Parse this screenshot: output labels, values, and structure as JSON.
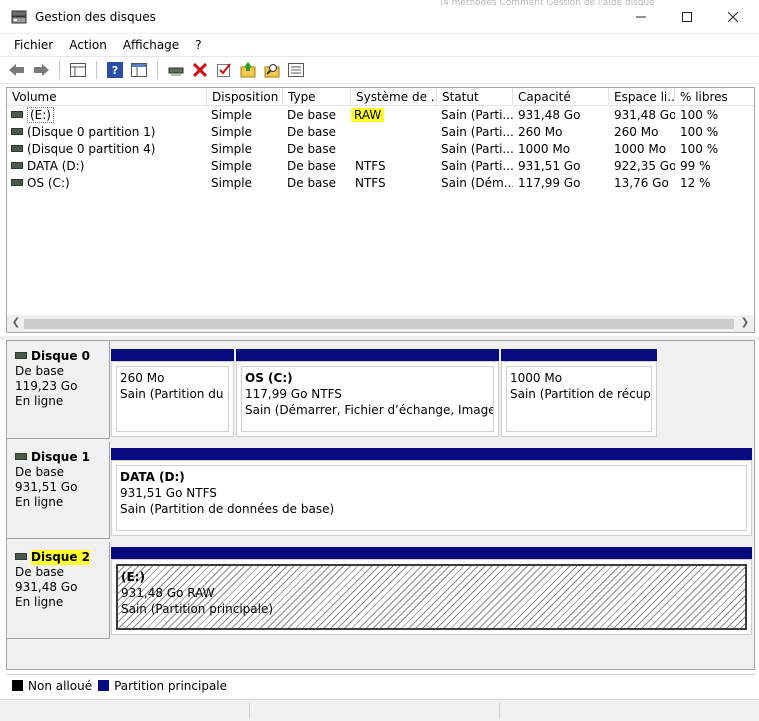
{
  "window": {
    "title": "Gestion des disques",
    "background_title_fragment": "|4 méthodes Comment Gestion de l'aide disque",
    "min_icon": "minimize-icon",
    "max_icon": "maximize-icon",
    "close_icon": "close-icon"
  },
  "menu": [
    "Fichier",
    "Action",
    "Affichage",
    "?"
  ],
  "toolbar": {
    "buttons": [
      "back-arrow-icon",
      "forward-arrow-icon",
      "properties-grid-icon",
      "help-icon",
      "console-icon",
      "connect-disk-icon",
      "delete-icon",
      "check-icon",
      "upload-folder-icon",
      "search-folder-icon",
      "list-view-icon"
    ]
  },
  "volume_list": {
    "columns": [
      "Volume",
      "Disposition",
      "Type",
      "Système de ...",
      "Statut",
      "Capacité",
      "Espace li...",
      "% libres"
    ],
    "rows": [
      {
        "volume": "(E:)",
        "disposition": "Simple",
        "type": "De base",
        "fs": "RAW",
        "status": "Sain (Parti...",
        "capacity": "931,48 Go",
        "free": "931,48 Go",
        "pct": "100 %"
      },
      {
        "volume": "(Disque 0 partition 1)",
        "disposition": "Simple",
        "type": "De base",
        "fs": "",
        "status": "Sain (Parti...",
        "capacity": "260 Mo",
        "free": "260 Mo",
        "pct": "100 %"
      },
      {
        "volume": "(Disque 0 partition 4)",
        "disposition": "Simple",
        "type": "De base",
        "fs": "",
        "status": "Sain (Parti...",
        "capacity": "1000 Mo",
        "free": "1000 Mo",
        "pct": "100 %"
      },
      {
        "volume": "DATA (D:)",
        "disposition": "Simple",
        "type": "De base",
        "fs": "NTFS",
        "status": "Sain (Parti...",
        "capacity": "931,51 Go",
        "free": "922,35 Go",
        "pct": "99 %"
      },
      {
        "volume": "OS (C:)",
        "disposition": "Simple",
        "type": "De base",
        "fs": "NTFS",
        "status": "Sain (Dém...",
        "capacity": "117,99 Go",
        "free": "13,76 Go",
        "pct": "12 %"
      }
    ]
  },
  "disks": [
    {
      "name": "Disque 0",
      "type": "De base",
      "size": "119,23 Go",
      "state": "En ligne",
      "partitions": [
        {
          "title": "",
          "size": "260 Mo",
          "status": "Sain (Partition du sys"
        },
        {
          "title": "OS  (C:)",
          "size": "117,99 Go NTFS",
          "status": "Sain (Démarrer, Fichier d’échange, Image mém"
        },
        {
          "title": "",
          "size": "1000 Mo",
          "status": "Sain (Partition de récupérat"
        }
      ]
    },
    {
      "name": "Disque 1",
      "type": "De base",
      "size": "931,51 Go",
      "state": "En ligne",
      "partitions": [
        {
          "title": "DATA  (D:)",
          "size": "931,51 Go NTFS",
          "status": "Sain (Partition de données de base)"
        }
      ]
    },
    {
      "name": "Disque 2",
      "type": "De base",
      "size": "931,48 Go",
      "state": "En ligne",
      "partitions": [
        {
          "title": "(E:)",
          "size": "931,48 Go RAW",
          "status": "Sain (Partition principale)"
        }
      ]
    }
  ],
  "legend": [
    {
      "label": "Non alloué",
      "color": "#000000"
    },
    {
      "label": "Partition principale",
      "color": "#0a0a80"
    }
  ],
  "colors": {
    "highlight": "#ffff2a",
    "partition_bar": "#0a0a80"
  }
}
